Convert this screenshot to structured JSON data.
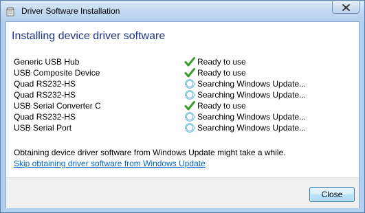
{
  "window": {
    "title": "Driver Software Installation"
  },
  "main": {
    "heading": "Installing device driver software",
    "devices": [
      {
        "name": "Generic USB Hub",
        "status": "Ready to use",
        "icon": "checkmark-icon"
      },
      {
        "name": "USB Composite Device",
        "status": "Ready to use",
        "icon": "checkmark-icon"
      },
      {
        "name": "Quad RS232-HS",
        "status": "Searching Windows Update...",
        "icon": "progress-ring-icon"
      },
      {
        "name": "Quad RS232-HS",
        "status": "Searching Windows Update...",
        "icon": "progress-ring-icon"
      },
      {
        "name": "USB Serial Converter C",
        "status": "Ready to use",
        "icon": "checkmark-icon"
      },
      {
        "name": "Quad RS232-HS",
        "status": "Searching Windows Update...",
        "icon": "progress-ring-icon"
      },
      {
        "name": "USB Serial Port",
        "status": "Searching Windows Update...",
        "icon": "progress-ring-icon"
      }
    ],
    "info_text": "Obtaining device driver software from Windows Update might take a while.",
    "skip_link": "Skip obtaining driver software from Windows Update"
  },
  "footer": {
    "close_label": "Close"
  },
  "colors": {
    "heading": "#1e3287",
    "link": "#0066cc",
    "check": "#3b9a2a",
    "ring": "#4aa3c8"
  }
}
